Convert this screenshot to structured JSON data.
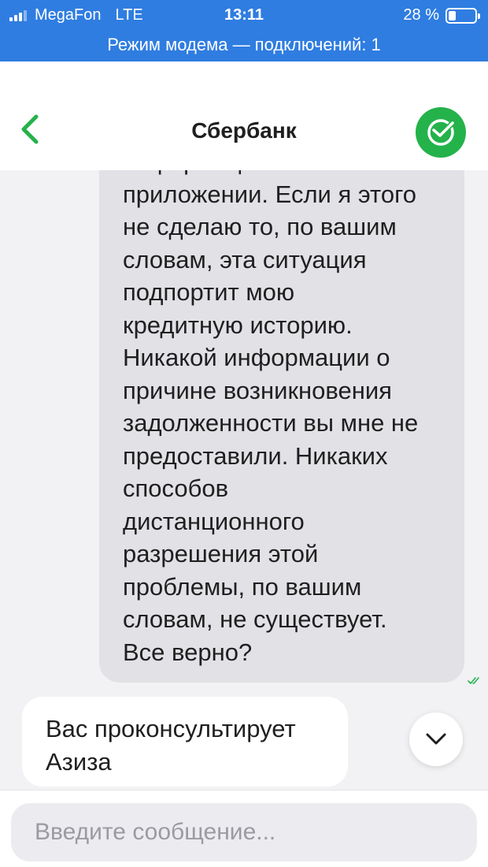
{
  "status_bar": {
    "carrier": "MegaFon",
    "network": "LTE",
    "time": "13:11",
    "battery": "28 %",
    "battery_level": 0.28
  },
  "hotspot_banner": "Режим модема — подключений: 1",
  "header": {
    "title": "Сбербанк"
  },
  "chat": {
    "messages": [
      {
        "direction": "outgoing",
        "lines": [
          "информации в",
          "приложении. Если я этого",
          "не сделаю то, по вашим",
          "словам, эта ситуация",
          "подпортит мою",
          "кредитную историю.",
          "Никакой информации о",
          "причине возникновения",
          "задолженности вы мне не",
          "предоставили. Никаких",
          "способов",
          "дистанционного",
          "разрешения этой",
          "проблемы, по вашим",
          "словам, не существует.",
          "Все верно?"
        ],
        "status": "read"
      },
      {
        "direction": "incoming",
        "lines": [
          "Вас проконсультирует",
          "Азиза"
        ]
      }
    ]
  },
  "composer": {
    "placeholder": "Введите сообщение..."
  },
  "colors": {
    "status_bar": "#2f7de1",
    "brand_green": "#24b24b",
    "outgoing_bubble": "#e1e1e6",
    "chat_background": "#f2f2f4"
  },
  "icons": {
    "back": "chevron-left-icon",
    "logo": "sberbank-logo-icon",
    "scroll": "chevron-down-icon",
    "read_status": "double-check-icon"
  }
}
